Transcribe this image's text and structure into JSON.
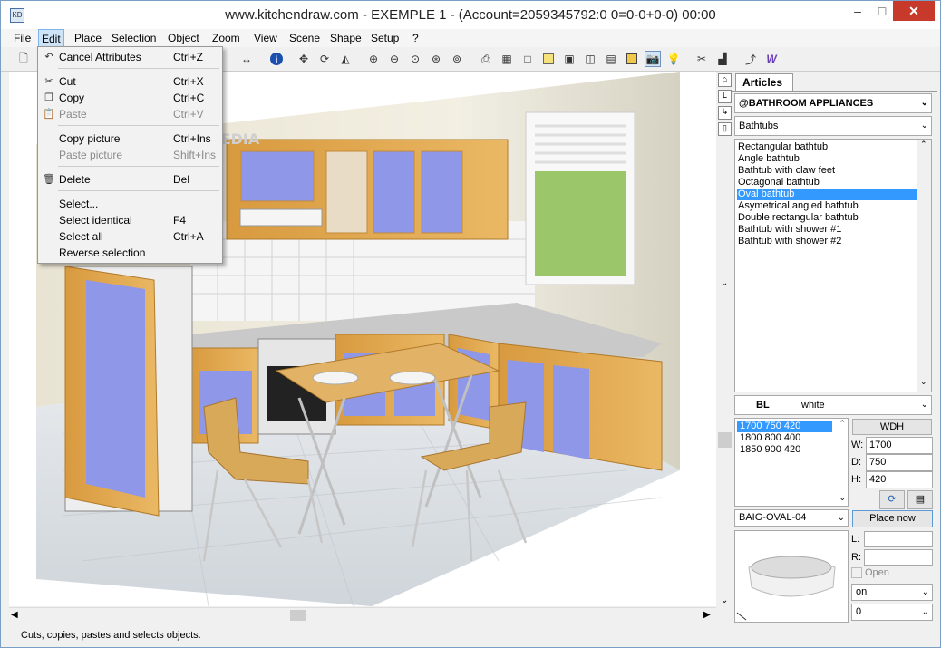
{
  "window": {
    "title": "www.kitchendraw.com - EXEMPLE 1 - (Account=2059345792:0 0=0-0+0-0) 00:00",
    "app_icon": "KD",
    "min": "–",
    "max": "□",
    "close": "✕"
  },
  "menubar": [
    "File",
    "Edit",
    "Place",
    "Selection",
    "Object",
    "Zoom",
    "View",
    "Scene",
    "Shape",
    "Setup",
    "?"
  ],
  "toolbar": {
    "icons": [
      "new-file",
      "undo",
      "redo",
      "cut",
      "copy",
      "measure",
      "info",
      "move",
      "rotate",
      "mirror",
      "zoom-in",
      "zoom-out",
      "zoom-window",
      "zoom-all",
      "zoom-plan",
      "print",
      "wireframe",
      "blank",
      "color",
      "box-3d",
      "cube-3d",
      "cube-front",
      "render-box",
      "camera",
      "light",
      "tools",
      "paint",
      "arrow-cursor",
      "pdf-w"
    ]
  },
  "edit_menu": {
    "items": [
      {
        "label": "Cancel Attributes",
        "shortcut": "Ctrl+Z",
        "icon": "undo-icon",
        "disabled": false
      },
      {
        "label": "Cut",
        "shortcut": "Ctrl+X",
        "icon": "scissors-icon",
        "disabled": false
      },
      {
        "label": "Copy",
        "shortcut": "Ctrl+C",
        "icon": "copy-icon",
        "disabled": false
      },
      {
        "label": "Paste",
        "shortcut": "Ctrl+V",
        "icon": "paste-icon",
        "disabled": true
      },
      {
        "label": "Copy picture",
        "shortcut": "Ctrl+Ins",
        "icon": "",
        "disabled": false
      },
      {
        "label": "Paste picture",
        "shortcut": "Shift+Ins",
        "icon": "",
        "disabled": true
      },
      {
        "label": "Delete",
        "shortcut": "Del",
        "icon": "trash-icon",
        "disabled": false
      },
      {
        "label": "Select...",
        "shortcut": "",
        "icon": "",
        "disabled": false
      },
      {
        "label": "Select identical",
        "shortcut": "F4",
        "icon": "",
        "disabled": false
      },
      {
        "label": "Select all",
        "shortcut": "Ctrl+A",
        "icon": "",
        "disabled": false
      },
      {
        "label": "Reverse selection",
        "shortcut": "",
        "icon": "",
        "disabled": false
      }
    ]
  },
  "panel": {
    "tab": "Articles",
    "catalog": "@BATHROOM APPLIANCES",
    "family": "Bathtubs",
    "articles": [
      "Rectangular bathtub",
      "Angle bathtub",
      "Bathtub with claw feet",
      "Octagonal bathtub",
      "Oval bathtub",
      "Asymetrical angled bathtub",
      "Double rectangular bathtub",
      "Bathtub with shower #1",
      "Bathtub with shower #2"
    ],
    "selected_article": 4,
    "finish_code": "BL",
    "finish_name": "white",
    "dimensions": [
      "1700  750  420",
      "1800  800  400",
      "1850  900  420"
    ],
    "selected_dimension": 0,
    "wdh_button": "WDH",
    "w_label": "W:",
    "w_value": "1700",
    "d_label": "D:",
    "d_value": "750",
    "h_label": "H:",
    "h_value": "420",
    "reference": "BAIG-OVAL-04",
    "place_now": "Place now",
    "l_label": "L:",
    "r_label": "R:",
    "open_label": "Open",
    "on_value": "on",
    "zero_value": "0"
  },
  "status": "Cuts, copies, pastes and selects objects.",
  "colors": {
    "accent": "#3399ff",
    "menu_highlight": "#cfe3f7",
    "close_red": "#c7392b",
    "cabinet_wood": "#e0a850",
    "door_blue": "#8f97e8"
  }
}
